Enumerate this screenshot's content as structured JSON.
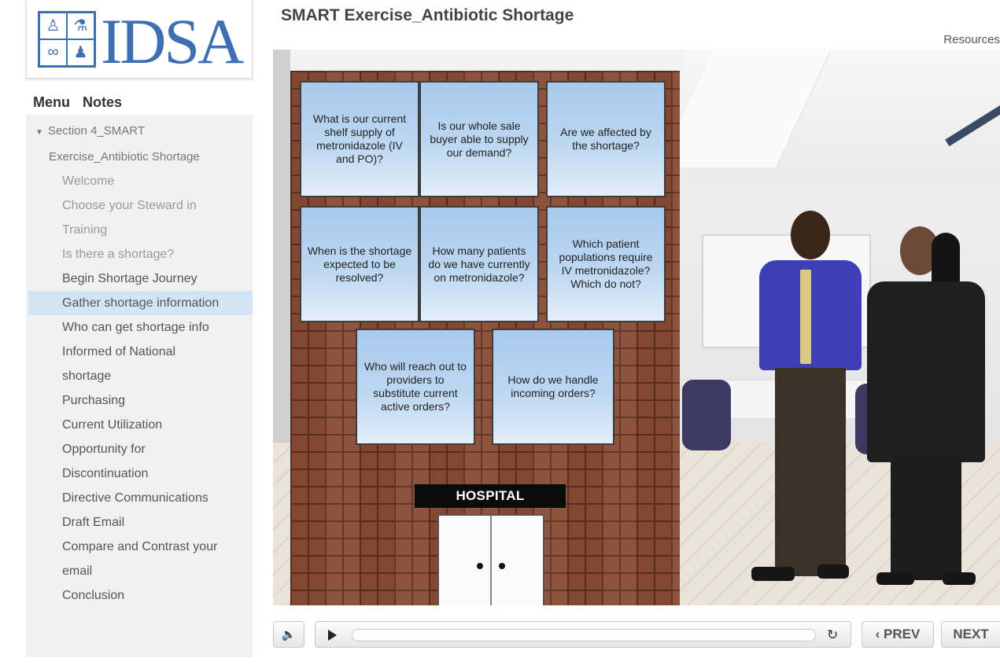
{
  "header": {
    "title": "SMART Exercise_Antibiotic Shortage",
    "resources_label": "Resources"
  },
  "logo": {
    "text": "IDSA",
    "emblem_icons": [
      "person-icon",
      "microscope-icon",
      "stethoscope-icon",
      "family-icon"
    ]
  },
  "sidebar": {
    "tabs": [
      {
        "label": "Menu"
      },
      {
        "label": "Notes"
      }
    ],
    "items": [
      {
        "label": "Section 4_SMART",
        "type": "section"
      },
      {
        "label": "Exercise_Antibiotic Shortage",
        "type": "section-cont"
      },
      {
        "label": "Welcome",
        "type": "visited"
      },
      {
        "label": "Choose your Steward in",
        "type": "visited"
      },
      {
        "label": "Training",
        "type": "visited"
      },
      {
        "label": "Is there a shortage?",
        "type": "visited"
      },
      {
        "label": "Begin Shortage Journey",
        "type": "normal"
      },
      {
        "label": "Gather shortage information",
        "type": "active"
      },
      {
        "label": "Who can get shortage info",
        "type": "normal"
      },
      {
        "label": "Informed of National",
        "type": "normal"
      },
      {
        "label": "shortage",
        "type": "normal"
      },
      {
        "label": "Purchasing",
        "type": "normal"
      },
      {
        "label": "Current Utilization",
        "type": "normal"
      },
      {
        "label": "Opportunity for",
        "type": "normal"
      },
      {
        "label": "Discontinuation",
        "type": "normal"
      },
      {
        "label": "Directive Communications",
        "type": "normal"
      },
      {
        "label": "Draft Email",
        "type": "normal"
      },
      {
        "label": "Compare and Contrast your",
        "type": "normal"
      },
      {
        "label": "email",
        "type": "normal"
      },
      {
        "label": "Conclusion",
        "type": "normal"
      }
    ]
  },
  "slide": {
    "signs": [
      "What is our current shelf supply of metronidazole (IV and PO)?",
      "Is our whole sale buyer able to supply our demand?",
      "Are we affected by the shortage?",
      "When is the shortage expected to be resolved?",
      "How many patients do we have currently on metronidazole?",
      "Which patient populations require IV metronidazole? Which do not?",
      "Who will reach out to providers to substitute current active orders?",
      "How do we handle incoming orders?"
    ],
    "building_label": "HOSPITAL"
  },
  "player": {
    "mute_icon": "speaker-icon",
    "play_icon": "play-icon",
    "replay_icon": "replay-icon",
    "replay_glyph": "↻",
    "prev_label": "‹ PREV",
    "next_label": "NEXT"
  },
  "colors": {
    "brand": "#3f6fb3",
    "active_item_bg": "#d3e4f4",
    "sidebar_bg": "#f1f1f1"
  }
}
